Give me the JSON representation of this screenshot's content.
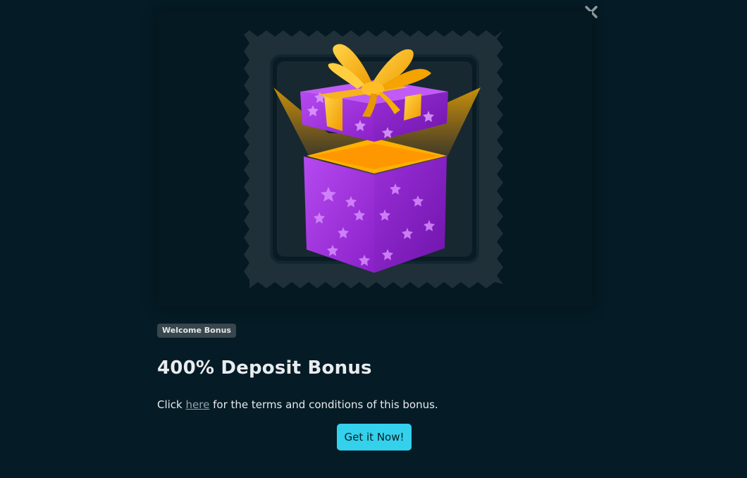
{
  "modal": {
    "badge": "Welcome Bonus",
    "title": "400% Deposit Bonus",
    "terms_prefix": "Click",
    "terms_link": "here",
    "terms_suffix": "for the terms and conditions of this bonus.",
    "cta_label": "Get it Now!"
  },
  "icons": {
    "close": "close-icon",
    "hero": "gift-box-illustration"
  },
  "colors": {
    "background": "#051b25",
    "badge": "#38464d",
    "cta": "#34d1ec",
    "link": "#8fa3ad",
    "gift_purple": "#a63ce0",
    "gift_gold": "#f3a900"
  }
}
